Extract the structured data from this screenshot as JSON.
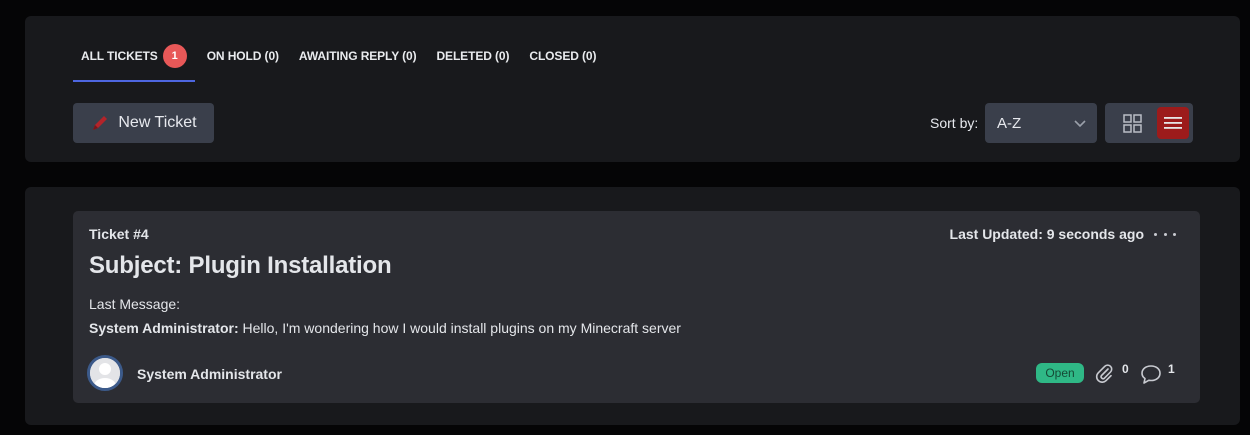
{
  "tabs": [
    {
      "label": "ALL TICKETS",
      "badge": "1"
    },
    {
      "label": "ON HOLD (0)"
    },
    {
      "label": "AWAITING REPLY (0)"
    },
    {
      "label": "DELETED (0)"
    },
    {
      "label": "CLOSED (0)"
    }
  ],
  "toolbar": {
    "new_ticket_label": "New Ticket",
    "sort_label": "Sort by:",
    "sort_value": "A-Z"
  },
  "ticket": {
    "number": "Ticket #4",
    "last_updated": "Last Updated: 9 seconds ago",
    "subject": "Subject: Plugin Installation",
    "last_message_label": "Last Message:",
    "last_message_author": "System Administrator:",
    "last_message_text": " Hello, I'm wondering how I would install plugins on my Minecraft server",
    "author": "System Administrator",
    "status": "Open",
    "attachments": "0",
    "comments": "1"
  },
  "colors": {
    "accent_underline": "#4d66e0",
    "badge": "#e85858",
    "status_open": "#2fb886",
    "list_view_active": "#9c1b1b"
  },
  "icons": [
    "pencil-icon",
    "chevron-down-icon",
    "grid-view-icon",
    "list-view-icon",
    "more-icon",
    "user-avatar",
    "paperclip-icon",
    "comment-icon"
  ]
}
